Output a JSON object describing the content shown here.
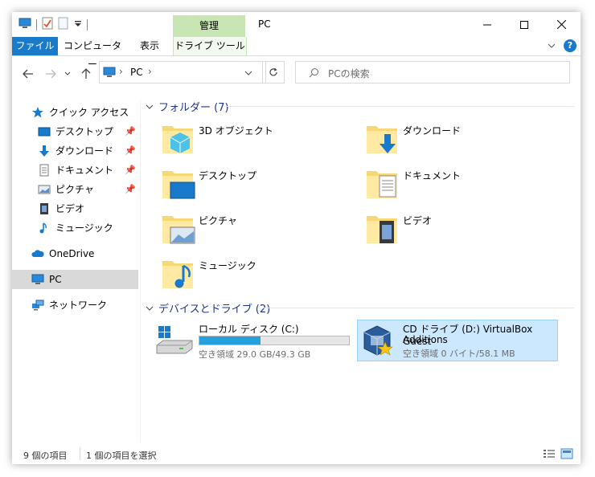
{
  "title_bar": {
    "context_tab": "管理",
    "title": "PC"
  },
  "ribbon": {
    "tabs": [
      "ファイル",
      "コンピューター",
      "表示",
      "ドライブ ツール"
    ]
  },
  "address_bar": {
    "path_label": "PC",
    "search_placeholder": "PCの検索"
  },
  "nav_pane": {
    "quick_access": "クイック アクセス",
    "items": [
      "デスクトップ",
      "ダウンロード",
      "ドキュメント",
      "ピクチャ",
      "ビデオ",
      "ミュージック"
    ],
    "onedrive": "OneDrive",
    "pc": "PC",
    "network": "ネットワーク"
  },
  "folders_group": {
    "header": "フォルダー (7)",
    "items": [
      "3D オブジェクト",
      "ダウンロード",
      "デスクトップ",
      "ドキュメント",
      "ピクチャ",
      "ビデオ",
      "ミュージック"
    ]
  },
  "drives_group": {
    "header": "デバイスとドライブ (2)",
    "c_drive": {
      "name": "ローカル ディスク (C:)",
      "free": "空き領域 29.0 GB/49.3 GB",
      "used_fraction": 0.41
    },
    "d_drive": {
      "name_line1": "CD ドライブ (D:) VirtualBox Guest",
      "name_line2": "Additions",
      "free": "空き領域 0 バイト/58.1 MB"
    }
  },
  "status_bar": {
    "item_count": "9 個の項目",
    "selected": "1 個の項目を選択"
  },
  "colors": {
    "accent": "#1979ca",
    "context_tab": "#c8e6b4",
    "selection": "#cce8ff",
    "progress": "#26a0da",
    "group_header": "#1e3287"
  }
}
